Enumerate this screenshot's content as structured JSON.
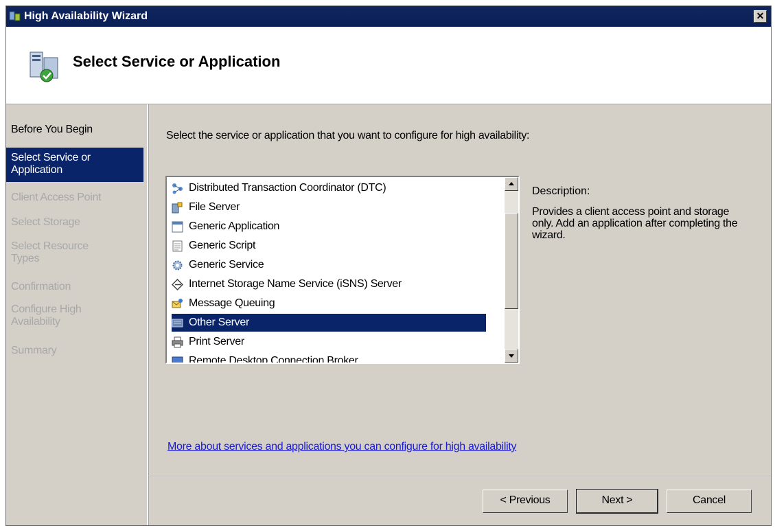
{
  "window": {
    "title": "High Availability Wizard",
    "close_glyph": "✕"
  },
  "header": {
    "title": "Select Service or Application"
  },
  "steps": [
    {
      "label": "Before You Begin",
      "state": "done"
    },
    {
      "label": "Select Service or Application",
      "state": "active"
    },
    {
      "label": "Client Access Point",
      "state": "pending"
    },
    {
      "label": "Select Storage",
      "state": "pending"
    },
    {
      "label": "Select Resource Types",
      "state": "pending"
    },
    {
      "label": "Confirmation",
      "state": "pending"
    },
    {
      "label": "Configure High Availability",
      "state": "pending"
    },
    {
      "label": "Summary",
      "state": "pending"
    }
  ],
  "main": {
    "prompt": "Select the service or application that you want to configure for high availability:",
    "items": [
      {
        "label": "Distributed Transaction Coordinator (DTC)",
        "icon": "dtc-icon"
      },
      {
        "label": "File Server",
        "icon": "file-server-icon"
      },
      {
        "label": "Generic Application",
        "icon": "generic-application-icon"
      },
      {
        "label": "Generic Script",
        "icon": "generic-script-icon"
      },
      {
        "label": "Generic Service",
        "icon": "gear-icon"
      },
      {
        "label": "Internet Storage Name Service (iSNS) Server",
        "icon": "isns-icon"
      },
      {
        "label": "Message Queuing",
        "icon": "message-queuing-icon"
      },
      {
        "label": "Other Server",
        "icon": "server-icon",
        "selected": true
      },
      {
        "label": "Print Server",
        "icon": "printer-icon"
      },
      {
        "label": "Remote Desktop Connection Broker",
        "icon": "remote-desktop-icon"
      }
    ],
    "description_label": "Description:",
    "description_text": "Provides a client access point and storage only. Add an application after completing the wizard.",
    "more_link": "More about services and applications you can configure for high availability"
  },
  "footer": {
    "previous": "< Previous",
    "next": "Next >",
    "cancel": "Cancel"
  },
  "colors": {
    "titlebar": "#0a1f55",
    "selection": "#0a246a",
    "face": "#d4d0c8",
    "link": "#1a1ad8"
  }
}
